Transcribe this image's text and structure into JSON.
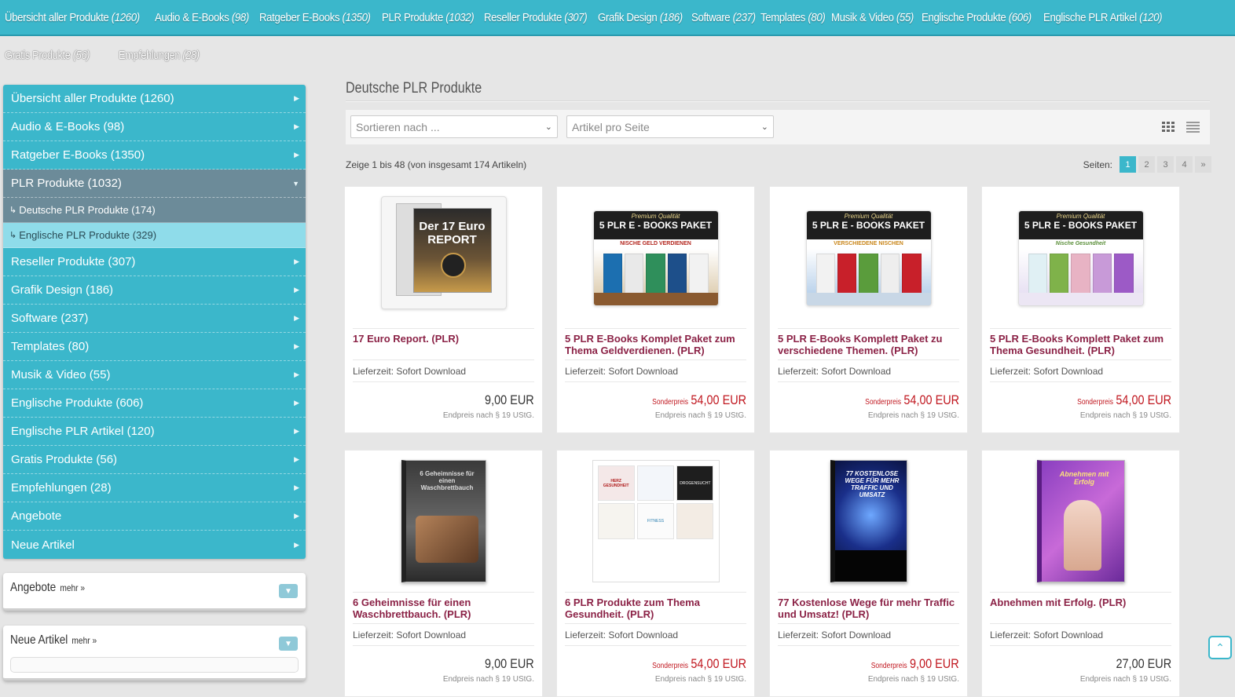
{
  "topnav": [
    {
      "label": "Übersicht aller Produkte",
      "count": "(1260)"
    },
    {
      "label": "Audio & E-Books",
      "count": "(98)"
    },
    {
      "label": "Ratgeber E-Books",
      "count": "(1350)"
    },
    {
      "label": "PLR Produkte",
      "count": "(1032)"
    },
    {
      "label": "Reseller Produkte",
      "count": "(307)"
    },
    {
      "label": "Grafik Design",
      "count": "(186)"
    },
    {
      "label": "Software",
      "count": "(237)"
    },
    {
      "label": "Templates",
      "count": "(80)"
    },
    {
      "label": "Musik & Video",
      "count": "(55)"
    },
    {
      "label": "Englische Produkte",
      "count": "(606)"
    },
    {
      "label": "Englische PLR Artikel",
      "count": "(120)"
    }
  ],
  "subnav": [
    {
      "label": "Gratis Produkte",
      "count": "(56)"
    },
    {
      "label": "Empfehlungen",
      "count": "(28)"
    }
  ],
  "sidebar": {
    "items": [
      {
        "label": "Übersicht aller Produkte (1260)"
      },
      {
        "label": "Audio & E-Books (98)"
      },
      {
        "label": "Ratgeber E-Books (1350)"
      },
      {
        "label": "PLR Produkte (1032)"
      },
      {
        "label": "Reseller Produkte (307)"
      },
      {
        "label": "Grafik Design (186)"
      },
      {
        "label": "Software (237)"
      },
      {
        "label": "Templates (80)"
      },
      {
        "label": "Musik & Video (55)"
      },
      {
        "label": "Englische Produkte (606)"
      },
      {
        "label": "Englische PLR Artikel (120)"
      },
      {
        "label": "Gratis Produkte (56)"
      },
      {
        "label": "Empfehlungen (28)"
      },
      {
        "label": "Angebote"
      },
      {
        "label": "Neue Artikel"
      }
    ],
    "subitems": [
      {
        "label": "Deutsche PLR Produkte (174)"
      },
      {
        "label": "Englische PLR Produkte (329)"
      }
    ]
  },
  "boxes": {
    "angebote": {
      "title": "Angebote",
      "more": "mehr »"
    },
    "neue": {
      "title": "Neue Artikel",
      "more": "mehr »"
    }
  },
  "main": {
    "title": "Deutsche PLR Produkte",
    "sort_placeholder": "Sortieren nach ...",
    "perpage_placeholder": "Artikel pro Seite",
    "result_info": "Zeige 1 bis 48 (von insgesamt 174 Artikeln)",
    "pages_label": "Seiten:",
    "pages": [
      "1",
      "2",
      "3",
      "4",
      "»"
    ]
  },
  "products": [
    {
      "name": "17 Euro Report. (PLR)",
      "delivery": "Lieferzeit: Sofort Download",
      "special_label": "",
      "price": "9,00 EUR",
      "tax": "Endpreis nach § 19 UStG.",
      "cover_text": "Der 17 Euro REPORT"
    },
    {
      "name": "5 PLR E-Books Komplet Paket zum Thema Geldverdienen. (PLR)",
      "delivery": "Lieferzeit: Sofort Download",
      "special_label": "Sonderpreis",
      "price": "54,00 EUR",
      "tax": "Endpreis nach § 19 UStG.",
      "cover_quality": "Premium Qualität",
      "cover_title": "5 PLR E - BOOKS PAKET",
      "cover_sub": "NISCHE GELD VERDIENEN"
    },
    {
      "name": "5 PLR E-Books Komplett Paket zu verschiedene Themen. (PLR)",
      "delivery": "Lieferzeit: Sofort Download",
      "special_label": "Sonderpreis",
      "price": "54,00 EUR",
      "tax": "Endpreis nach § 19 UStG.",
      "cover_quality": "Premium Qualität",
      "cover_title": "5 PLR E - BOOKS PAKET",
      "cover_sub": "VERSCHIEDENE NISCHEN"
    },
    {
      "name": "5 PLR E-Books Komplett Paket zum Thema Gesundheit. (PLR)",
      "delivery": "Lieferzeit: Sofort Download",
      "special_label": "Sonderpreis",
      "price": "54,00 EUR",
      "tax": "Endpreis nach § 19 UStG.",
      "cover_quality": "Premium Qualität",
      "cover_title": "5 PLR E - BOOKS PAKET",
      "cover_sub": "Nische Gesundheit"
    },
    {
      "name": "6 Geheimnisse für einen Waschbrettbauch. (PLR)",
      "delivery": "Lieferzeit: Sofort Download",
      "special_label": "",
      "price": "9,00 EUR",
      "tax": "Endpreis nach § 19 UStG.",
      "cover_text": "6 Geheimnisse für einen Waschbrettbauch"
    },
    {
      "name": "6 PLR Produkte zum Thema Gesundheit. (PLR)",
      "delivery": "Lieferzeit: Sofort Download",
      "special_label": "Sonderpreis",
      "price": "54,00 EUR",
      "tax": "Endpreis nach § 19 UStG.",
      "cover_tiles": [
        "HERZ GESUNDHEIT",
        "",
        "DROGENSUCHT",
        "",
        "FITNESS",
        ""
      ]
    },
    {
      "name": "77 Kostenlose Wege für mehr Traffic und Umsatz! (PLR)",
      "delivery": "Lieferzeit: Sofort Download",
      "special_label": "Sonderpreis",
      "price": "9,00 EUR",
      "tax": "Endpreis nach § 19 UStG.",
      "cover_text": "77 KOSTENLOSE WEGE FÜR MEHR TRAFFIC UND UMSATZ"
    },
    {
      "name": "Abnehmen mit Erfolg. (PLR)",
      "delivery": "Lieferzeit: Sofort Download",
      "special_label": "",
      "price": "27,00 EUR",
      "tax": "Endpreis nach § 19 UStG.",
      "cover_text": "Abnehmen mit Erfolg"
    }
  ],
  "colors": {
    "accent": "#3bb7cb",
    "active": "#6c8b99",
    "product_name": "#8b2246",
    "special_price": "#c0161e"
  }
}
